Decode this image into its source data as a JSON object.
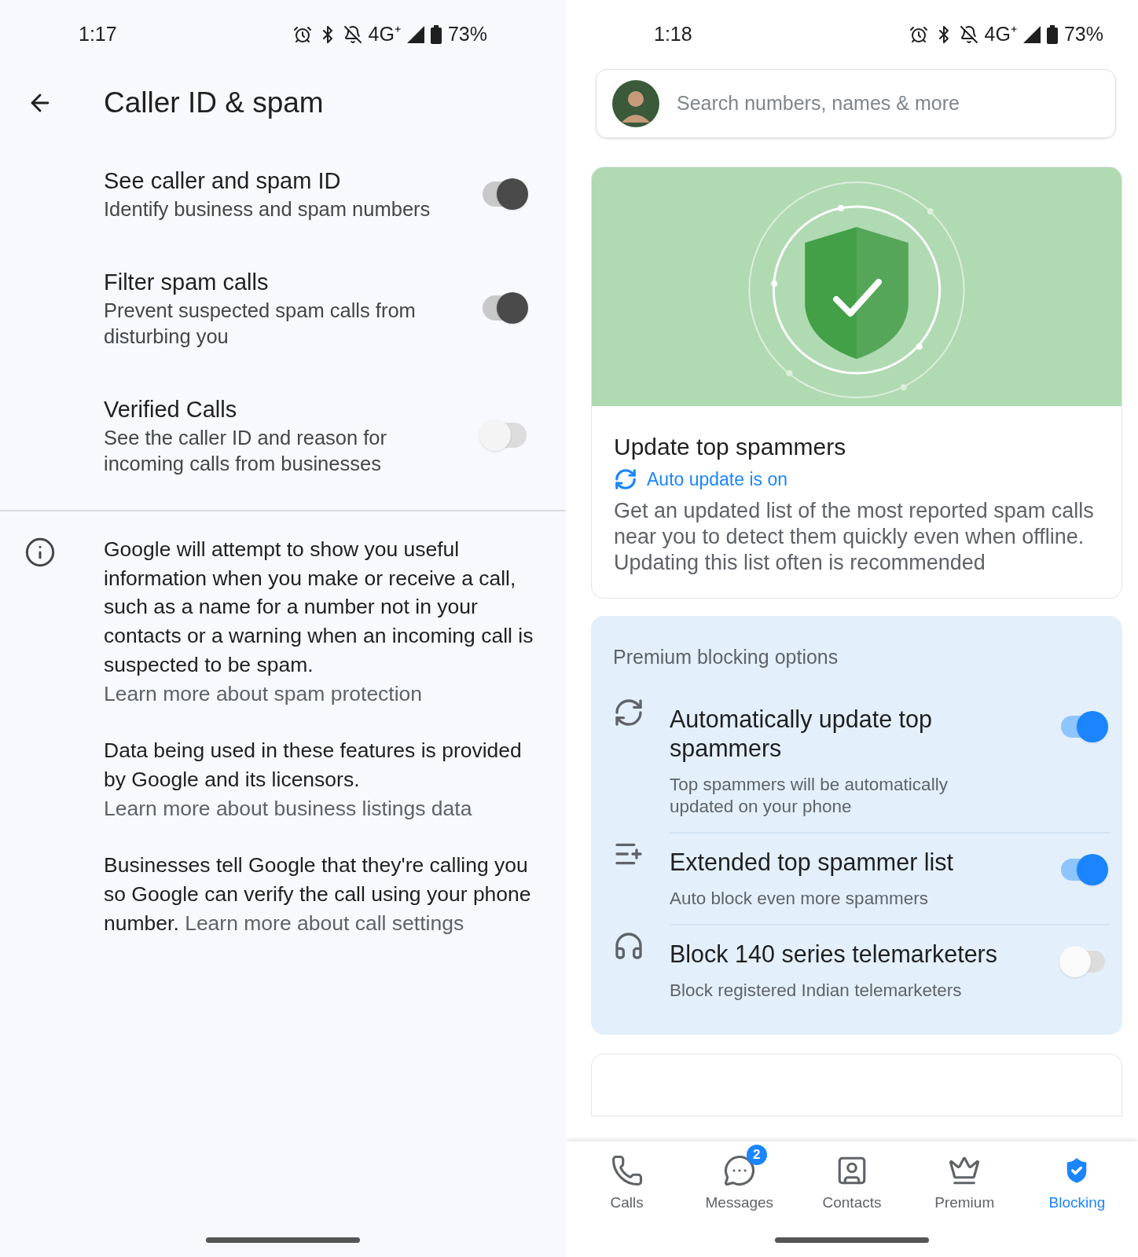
{
  "left": {
    "status_bar": {
      "time": "1:17",
      "network": "4G⁺",
      "battery": "73%"
    },
    "header": {
      "title": "Caller ID & spam"
    },
    "settings": [
      {
        "title": "See caller and spam ID",
        "subtitle": "Identify business and spam numbers",
        "on": true
      },
      {
        "title": "Filter spam calls",
        "subtitle": "Prevent suspected spam calls from disturbing you",
        "on": true
      },
      {
        "title": "Verified Calls",
        "subtitle": "See the caller ID and reason for incoming calls from businesses",
        "on": false
      }
    ],
    "info_paragraphs": [
      {
        "text": "Google will attempt to show you useful information when you make or receive a call, such as a name for a number not in your contacts or a warning when an incoming call is suspected to be spam.",
        "link": "Learn more about spam protection"
      },
      {
        "text": "Data being used in these features is provided by Google and its licensors.",
        "link": "Learn more about business listings data"
      },
      {
        "text": "Businesses tell Google that they're calling you so Google can verify the call using your phone number.",
        "link": "Learn more about call settings"
      }
    ]
  },
  "right": {
    "status_bar": {
      "time": "1:18",
      "network": "4G⁺",
      "battery": "73%"
    },
    "search": {
      "placeholder": "Search numbers, names & more"
    },
    "update_card": {
      "title": "Update top spammers",
      "status": "Auto update is on",
      "description": "Get an updated list of the most reported spam calls near you to detect them quickly even when offline. Updating this list often is recommended"
    },
    "premium": {
      "heading": "Premium blocking options",
      "options": [
        {
          "kind": "sync",
          "title": "Automatically update top spammers",
          "subtitle": "Top spammers will be automatically updated on your phone",
          "on": true
        },
        {
          "kind": "list",
          "title": "Extended top spammer list",
          "subtitle": "Auto block even more spammers",
          "on": true
        },
        {
          "kind": "headset",
          "title": "Block 140 series telemarketers",
          "subtitle": "Block registered Indian telemarketers",
          "on": false
        }
      ]
    },
    "bottom_nav": [
      {
        "kind": "calls",
        "label": "Calls",
        "selected": false
      },
      {
        "kind": "messages",
        "label": "Messages",
        "selected": false,
        "badge": "2"
      },
      {
        "kind": "contacts",
        "label": "Contacts",
        "selected": false
      },
      {
        "kind": "premium",
        "label": "Premium",
        "selected": false
      },
      {
        "kind": "blocking",
        "label": "Blocking",
        "selected": true
      }
    ]
  }
}
